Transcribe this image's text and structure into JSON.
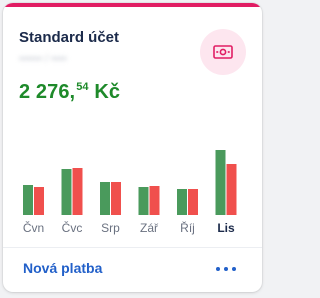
{
  "colors": {
    "accent": "#e11d63",
    "title": "#1b2a4a",
    "balance": "#1e8a2a",
    "link": "#2260c9",
    "bar_income": "#4a9a5c",
    "bar_expense": "#f0504d",
    "axis_text": "#6a7180",
    "axis_text_active": "#1b2a4a"
  },
  "account": {
    "title": "Standard účet",
    "number": "•••••• / ••••",
    "balance_main": "2 276,",
    "balance_decimals": "54",
    "currency": " Kč",
    "icon": "banknote-icon"
  },
  "actions": {
    "new_payment_label": "Nová platba",
    "more_icon": "more-dots-icon"
  },
  "chart_data": {
    "type": "bar",
    "categories": [
      "Čvn",
      "Čvc",
      "Srp",
      "Zář",
      "Říj",
      "Lis"
    ],
    "active_category": "Lis",
    "series": [
      {
        "values": [
          30,
          46,
          33,
          28,
          26,
          65
        ]
      },
      {
        "values": [
          28,
          47,
          33,
          29,
          26,
          51
        ]
      }
    ],
    "ylim": [
      0,
      70
    ],
    "grid": false
  }
}
